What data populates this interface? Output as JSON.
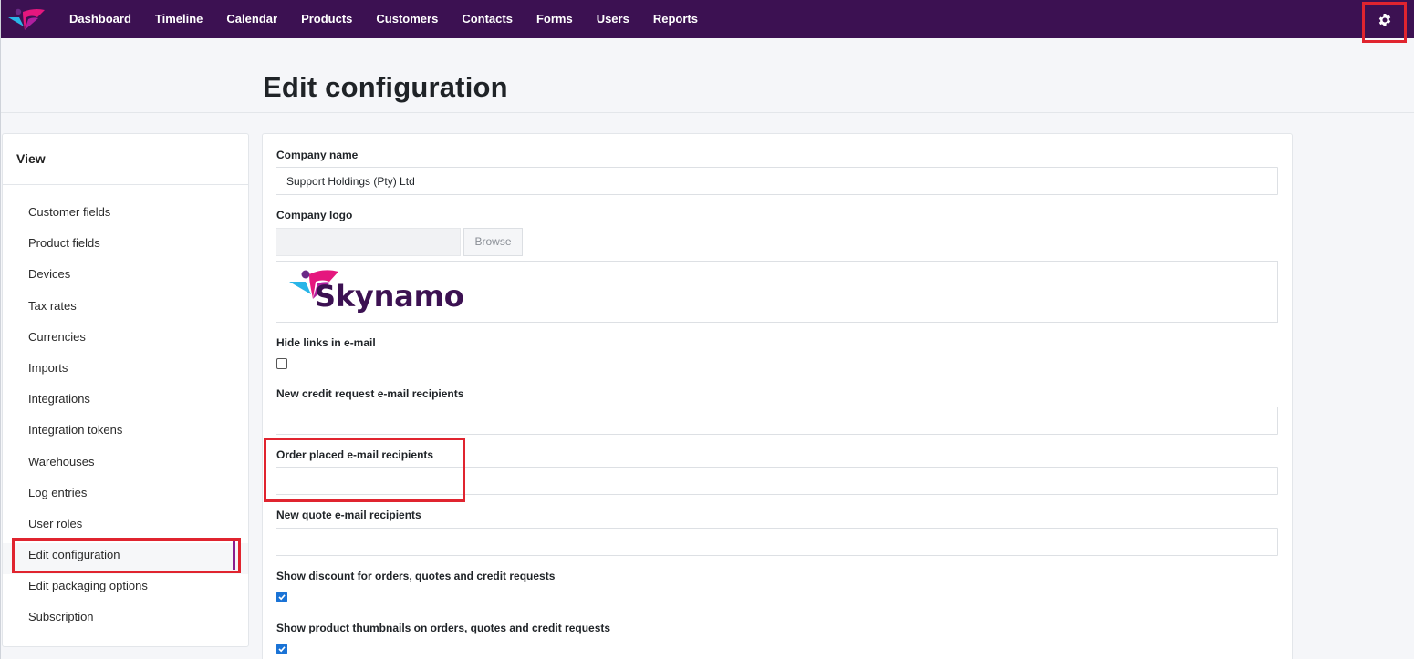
{
  "nav": {
    "items": [
      "Dashboard",
      "Timeline",
      "Calendar",
      "Products",
      "Customers",
      "Contacts",
      "Forms",
      "Users",
      "Reports"
    ],
    "settings_icon": "gear-icon"
  },
  "header": {
    "title": "Edit configuration"
  },
  "sidebar": {
    "heading": "View",
    "items": [
      {
        "label": "Customer fields"
      },
      {
        "label": "Product fields"
      },
      {
        "label": "Devices"
      },
      {
        "label": "Tax rates"
      },
      {
        "label": "Currencies"
      },
      {
        "label": "Imports"
      },
      {
        "label": "Integrations"
      },
      {
        "label": "Integration tokens"
      },
      {
        "label": "Warehouses"
      },
      {
        "label": "Log entries"
      },
      {
        "label": "User roles"
      },
      {
        "label": "Edit configuration"
      },
      {
        "label": "Edit packaging options"
      },
      {
        "label": "Subscription"
      }
    ],
    "active_item": "Edit configuration"
  },
  "form": {
    "company_name_label": "Company name",
    "company_name_value": "Support Holdings (Pty) Ltd",
    "company_logo_label": "Company logo",
    "browse_label": "Browse",
    "logo_text": "Skynamo",
    "hide_links_label": "Hide links in e-mail",
    "hide_links_checked": false,
    "credit_request_label": "New credit request e-mail recipients",
    "credit_request_value": "",
    "order_placed_label": "Order placed e-mail recipients",
    "order_placed_value": "",
    "new_quote_label": "New quote e-mail recipients",
    "new_quote_value": "",
    "show_discount_label": "Show discount for orders, quotes and credit requests",
    "show_discount_checked": true,
    "show_thumbnails_label": "Show product thumbnails on orders, quotes and credit requests",
    "show_thumbnails_checked": true
  },
  "colors": {
    "nav_bg": "#3c1152",
    "highlight": "#e0242f",
    "checkbox": "#1a73d6",
    "brand": "#3c1152",
    "logo_pink": "#e5177e",
    "logo_blue": "#29b5e8"
  }
}
